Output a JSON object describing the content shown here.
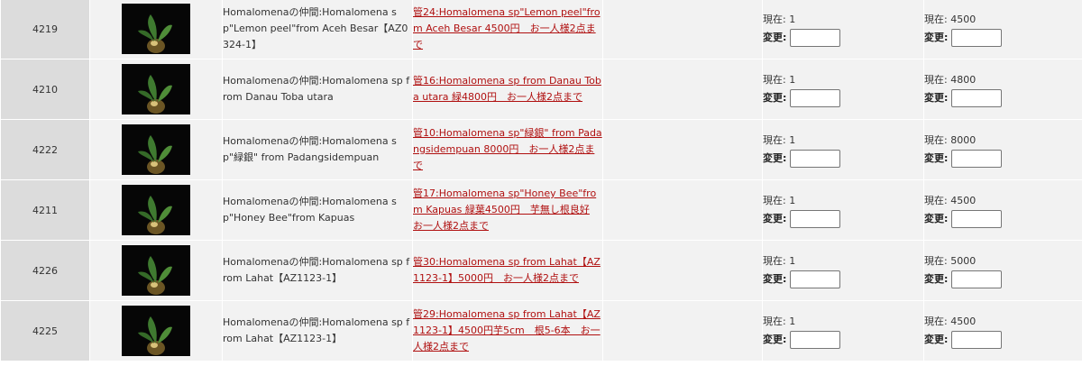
{
  "colors": {
    "link": "#b01010",
    "cell_bg": "#f2f2f2",
    "id_bg": "#dcdcdc"
  },
  "rows": [
    {
      "id": "4219",
      "thumb_icon": "plant-photo",
      "name": "Homalomenaの仲間:Homalomena sp\"Lemon peel\"from Aceh Besar【AZ0324-1】",
      "desc": "管24:Homalomena sp\"Lemon peel\"from Aceh Besar 4500円　お一人様2点まで",
      "stock_label": "現在: 1",
      "stock_change_label": "変更:",
      "stock_value": "",
      "price_label": "現在: 4500",
      "price_change_label": "変更:",
      "price_value": ""
    },
    {
      "id": "4210",
      "thumb_icon": "plant-photo",
      "name": "Homalomenaの仲間:Homalomena sp from Danau Toba utara",
      "desc": "管16:Homalomena sp from Danau Toba utara 緑4800円　お一人様2点まで",
      "stock_label": "現在: 1",
      "stock_change_label": "変更:",
      "stock_value": "",
      "price_label": "現在: 4800",
      "price_change_label": "変更:",
      "price_value": ""
    },
    {
      "id": "4222",
      "thumb_icon": "plant-photo",
      "name": "Homalomenaの仲間:Homalomena sp\"緑銀\" from Padangsidempuan",
      "desc": "管10:Homalomena sp\"緑銀\" from Padangsidempuan 8000円　お一人様2点まで",
      "stock_label": "現在: 1",
      "stock_change_label": "変更:",
      "stock_value": "",
      "price_label": "現在: 8000",
      "price_change_label": "変更:",
      "price_value": ""
    },
    {
      "id": "4211",
      "thumb_icon": "plant-photo",
      "name": "Homalomenaの仲間:Homalomena sp\"Honey Bee\"from Kapuas",
      "desc": "管17:Homalomena sp\"Honey Bee\"from Kapuas 緑葉4500円　芋無し根良好 お一人様2点まで",
      "stock_label": "現在: 1",
      "stock_change_label": "変更:",
      "stock_value": "",
      "price_label": "現在: 4500",
      "price_change_label": "変更:",
      "price_value": ""
    },
    {
      "id": "4226",
      "thumb_icon": "plant-photo",
      "name": "Homalomenaの仲間:Homalomena sp from Lahat【AZ1123-1】",
      "desc": "管30:Homalomena sp from Lahat【AZ1123-1】5000円　お一人様2点まで",
      "stock_label": "現在: 1",
      "stock_change_label": "変更:",
      "stock_value": "",
      "price_label": "現在: 5000",
      "price_change_label": "変更:",
      "price_value": ""
    },
    {
      "id": "4225",
      "thumb_icon": "plant-photo",
      "name": "Homalomenaの仲間:Homalomena sp from Lahat【AZ1123-1】",
      "desc": "管29:Homalomena sp from Lahat【AZ1123-1】4500円芋5cm　根5-6本　お一人様2点まで",
      "stock_label": "現在: 1",
      "stock_change_label": "変更:",
      "stock_value": "",
      "price_label": "現在: 4500",
      "price_change_label": "変更:",
      "price_value": ""
    }
  ]
}
